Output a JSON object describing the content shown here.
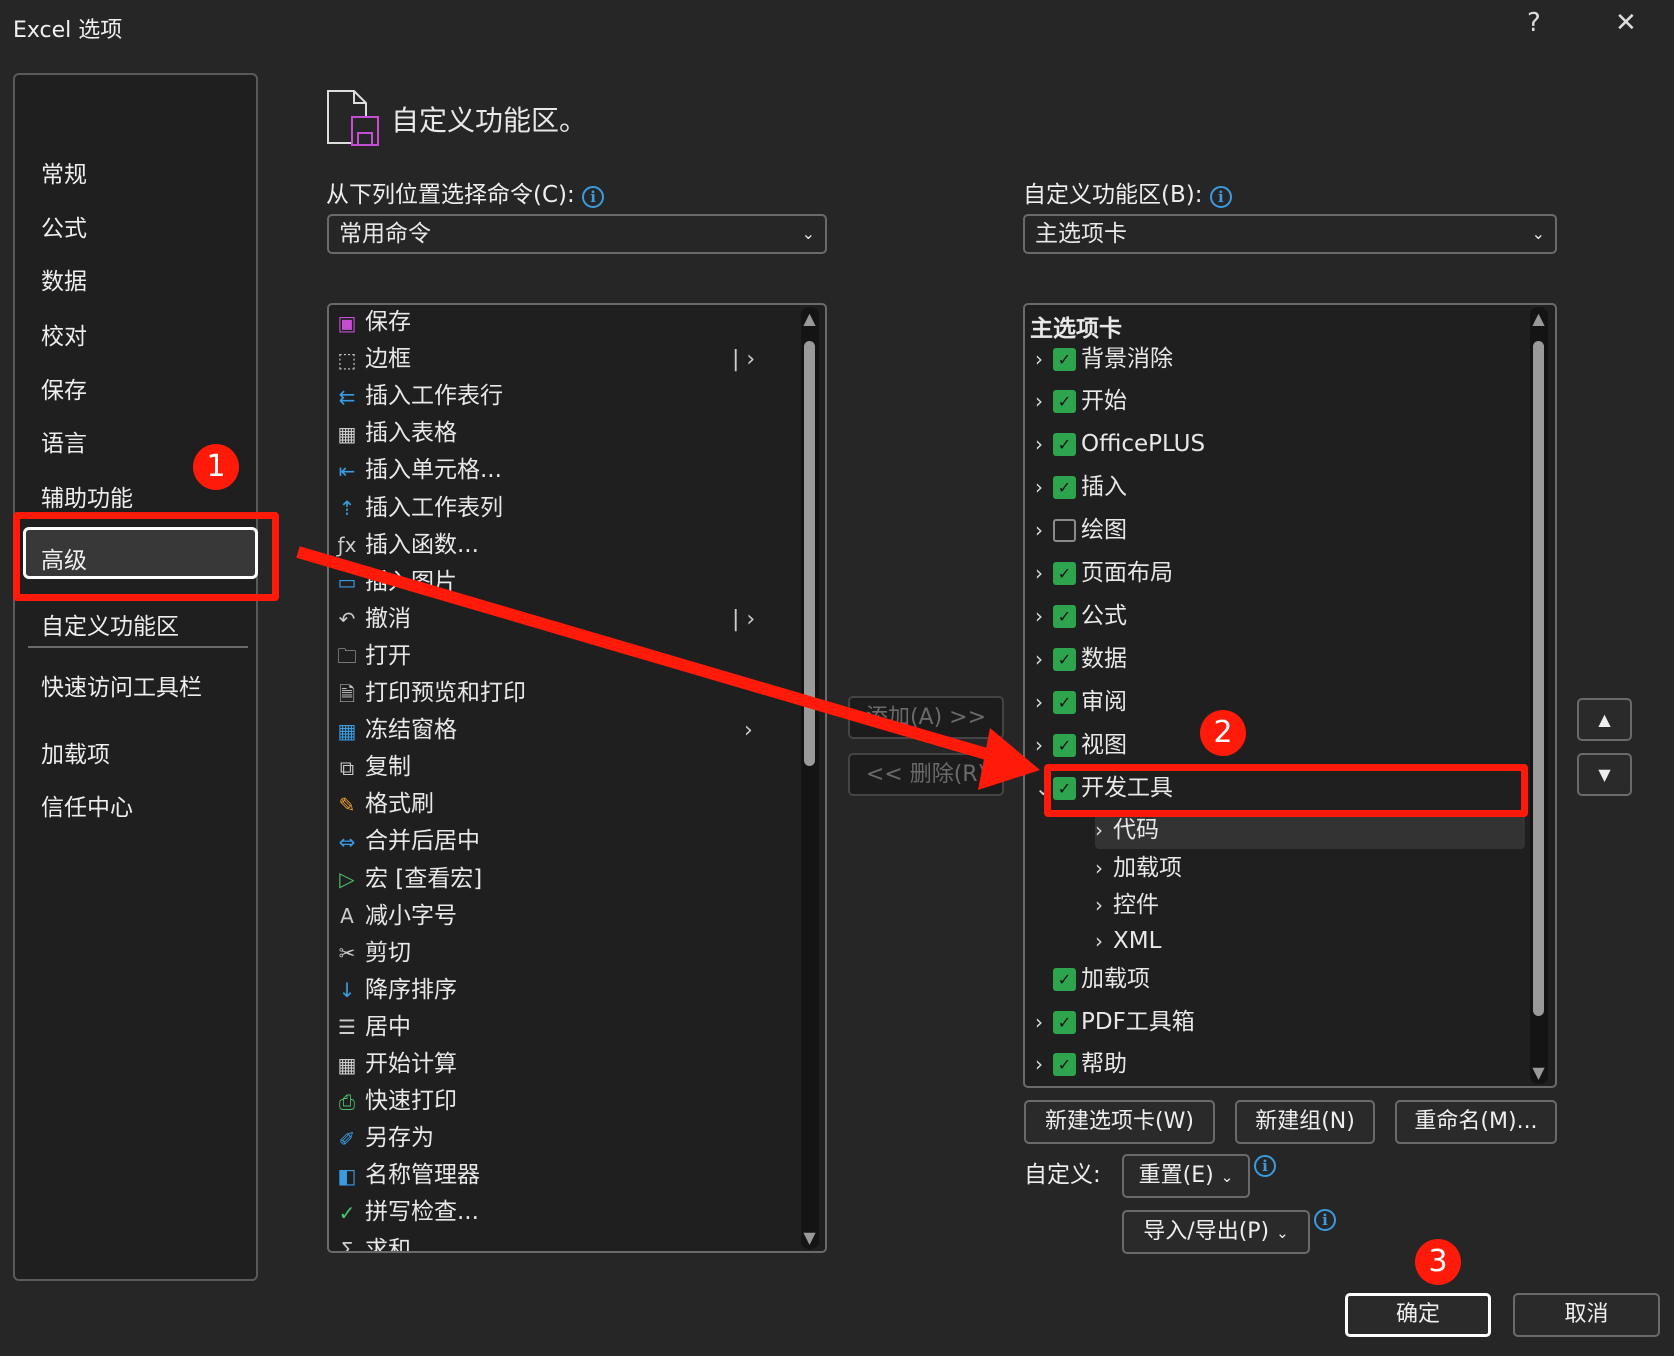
{
  "window": {
    "title": "Excel 选项",
    "help": "?",
    "close": "✕"
  },
  "nav": {
    "items": [
      "常规",
      "公式",
      "数据",
      "校对",
      "保存",
      "语言",
      "辅助功能",
      "高级",
      "自定义功能区",
      "快速访问工具栏",
      "加载项",
      "信任中心"
    ],
    "selected": "自定义功能区"
  },
  "header": {
    "title": "自定义功能区。"
  },
  "left": {
    "label": "从下列位置选择命令(C):",
    "dropdown": "常用命令",
    "commands": [
      {
        "label": "保存",
        "icon": "save-icon"
      },
      {
        "label": "边框",
        "icon": "border-icon",
        "submenu": "split"
      },
      {
        "label": "插入工作表行",
        "icon": "insert-row-icon"
      },
      {
        "label": "插入表格",
        "icon": "table-icon"
      },
      {
        "label": "插入单元格...",
        "icon": "insert-cells-icon"
      },
      {
        "label": "插入工作表列",
        "icon": "insert-column-icon"
      },
      {
        "label": "插入函数...",
        "icon": "function-icon"
      },
      {
        "label": "插入图片",
        "icon": "picture-icon"
      },
      {
        "label": "撤消",
        "icon": "undo-icon",
        "submenu": "split"
      },
      {
        "label": "打开",
        "icon": "folder-icon"
      },
      {
        "label": "打印预览和打印",
        "icon": "print-preview-icon"
      },
      {
        "label": "冻结窗格",
        "icon": "freeze-panes-icon",
        "submenu": "arrow"
      },
      {
        "label": "复制",
        "icon": "copy-icon"
      },
      {
        "label": "格式刷",
        "icon": "format-painter-icon"
      },
      {
        "label": "合并后居中",
        "icon": "merge-center-icon"
      },
      {
        "label": "宏 [查看宏]",
        "icon": "macro-play-icon"
      },
      {
        "label": "减小字号",
        "icon": "decrease-font-icon"
      },
      {
        "label": "剪切",
        "icon": "scissors-icon"
      },
      {
        "label": "降序排序",
        "icon": "sort-desc-icon"
      },
      {
        "label": "居中",
        "icon": "align-center-icon"
      },
      {
        "label": "开始计算",
        "icon": "calculator-icon"
      },
      {
        "label": "快速打印",
        "icon": "quick-print-icon"
      },
      {
        "label": "另存为",
        "icon": "save-as-icon"
      },
      {
        "label": "名称管理器",
        "icon": "name-manager-icon"
      },
      {
        "label": "拼写检查...",
        "icon": "spell-check-icon"
      },
      {
        "label": "求和",
        "icon": "sum-icon"
      }
    ]
  },
  "middle": {
    "add": "添加(A) >>",
    "remove": "<< 删除(R)"
  },
  "right": {
    "label": "自定义功能区(B):",
    "dropdown": "主选项卡",
    "tree_header": "主选项卡",
    "tree": [
      {
        "label": "背景消除",
        "checked": true,
        "expand": "collapsed",
        "level": 0
      },
      {
        "label": "开始",
        "checked": true,
        "expand": "collapsed",
        "level": 0
      },
      {
        "label": "OfficePLUS",
        "checked": true,
        "expand": "collapsed",
        "level": 0
      },
      {
        "label": "插入",
        "checked": true,
        "expand": "collapsed",
        "level": 0
      },
      {
        "label": "绘图",
        "checked": false,
        "expand": "collapsed",
        "level": 0
      },
      {
        "label": "页面布局",
        "checked": true,
        "expand": "collapsed",
        "level": 0
      },
      {
        "label": "公式",
        "checked": true,
        "expand": "collapsed",
        "level": 0
      },
      {
        "label": "数据",
        "checked": true,
        "expand": "collapsed",
        "level": 0
      },
      {
        "label": "审阅",
        "checked": true,
        "expand": "collapsed",
        "level": 0
      },
      {
        "label": "视图",
        "checked": true,
        "expand": "collapsed",
        "level": 0
      },
      {
        "label": "开发工具",
        "checked": true,
        "expand": "expanded",
        "level": 0
      },
      {
        "label": "代码",
        "expand": "collapsed",
        "level": 1
      },
      {
        "label": "加载项",
        "expand": "collapsed",
        "level": 1
      },
      {
        "label": "控件",
        "expand": "collapsed",
        "level": 1
      },
      {
        "label": "XML",
        "expand": "collapsed",
        "level": 1
      },
      {
        "label": "加载项",
        "checked": true,
        "expand": "none",
        "level": 0
      },
      {
        "label": "PDF工具箱",
        "checked": true,
        "expand": "collapsed",
        "level": 0
      },
      {
        "label": "帮助",
        "checked": true,
        "expand": "collapsed",
        "level": 0
      }
    ],
    "new_tab": "新建选项卡(W)",
    "new_group": "新建组(N)",
    "rename": "重命名(M)...",
    "customize_label": "自定义:",
    "reset": "重置(E)",
    "import_export": "导入/导出(P)"
  },
  "footer": {
    "ok": "确定",
    "cancel": "取消"
  },
  "annotations": {
    "step1": "1",
    "step2": "2",
    "step3": "3",
    "color": "#ff1a0a"
  },
  "colors": {
    "checkbox": "#2ea44f",
    "info": "#3a9be0"
  }
}
